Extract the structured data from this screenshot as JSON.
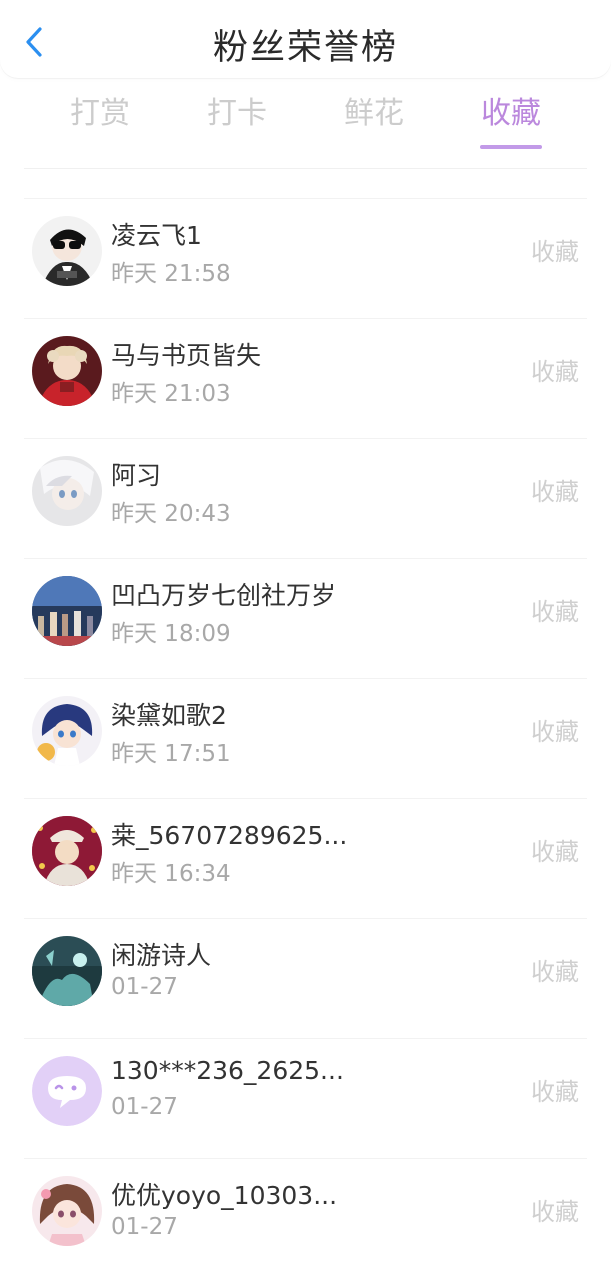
{
  "header": {
    "title": "粉丝荣誉榜"
  },
  "tabs": [
    {
      "label": "打赏",
      "active": false
    },
    {
      "label": "打卡",
      "active": false
    },
    {
      "label": "鲜花",
      "active": false
    },
    {
      "label": "收藏",
      "active": true
    }
  ],
  "colors": {
    "accent": "#bb88dd",
    "tab_inactive": "#cccccc",
    "text_primary": "#333333",
    "text_secondary": "#a8a8a8",
    "action_text": "#cfcfcf"
  },
  "fans": [
    {
      "name": "凌云飞1",
      "time": "昨天 21:58",
      "action": "收藏"
    },
    {
      "name": "马与书页皆失",
      "time": "昨天 21:03",
      "action": "收藏"
    },
    {
      "name": "阿习",
      "time": "昨天 20:43",
      "action": "收藏"
    },
    {
      "name": "凹凸万岁七创社万岁",
      "time": "昨天 18:09",
      "action": "收藏"
    },
    {
      "name": "染黛如歌2",
      "time": "昨天 17:51",
      "action": "收藏"
    },
    {
      "name": "桒_56707289625...",
      "time": "昨天 16:34",
      "action": "收藏"
    },
    {
      "name": "闲游诗人",
      "time": "01-27",
      "action": "收藏"
    },
    {
      "name": "130***236_2625...",
      "time": "01-27",
      "action": "收藏"
    },
    {
      "name": "优优yoyo_10303...",
      "time": "01-27",
      "action": "收藏"
    }
  ]
}
